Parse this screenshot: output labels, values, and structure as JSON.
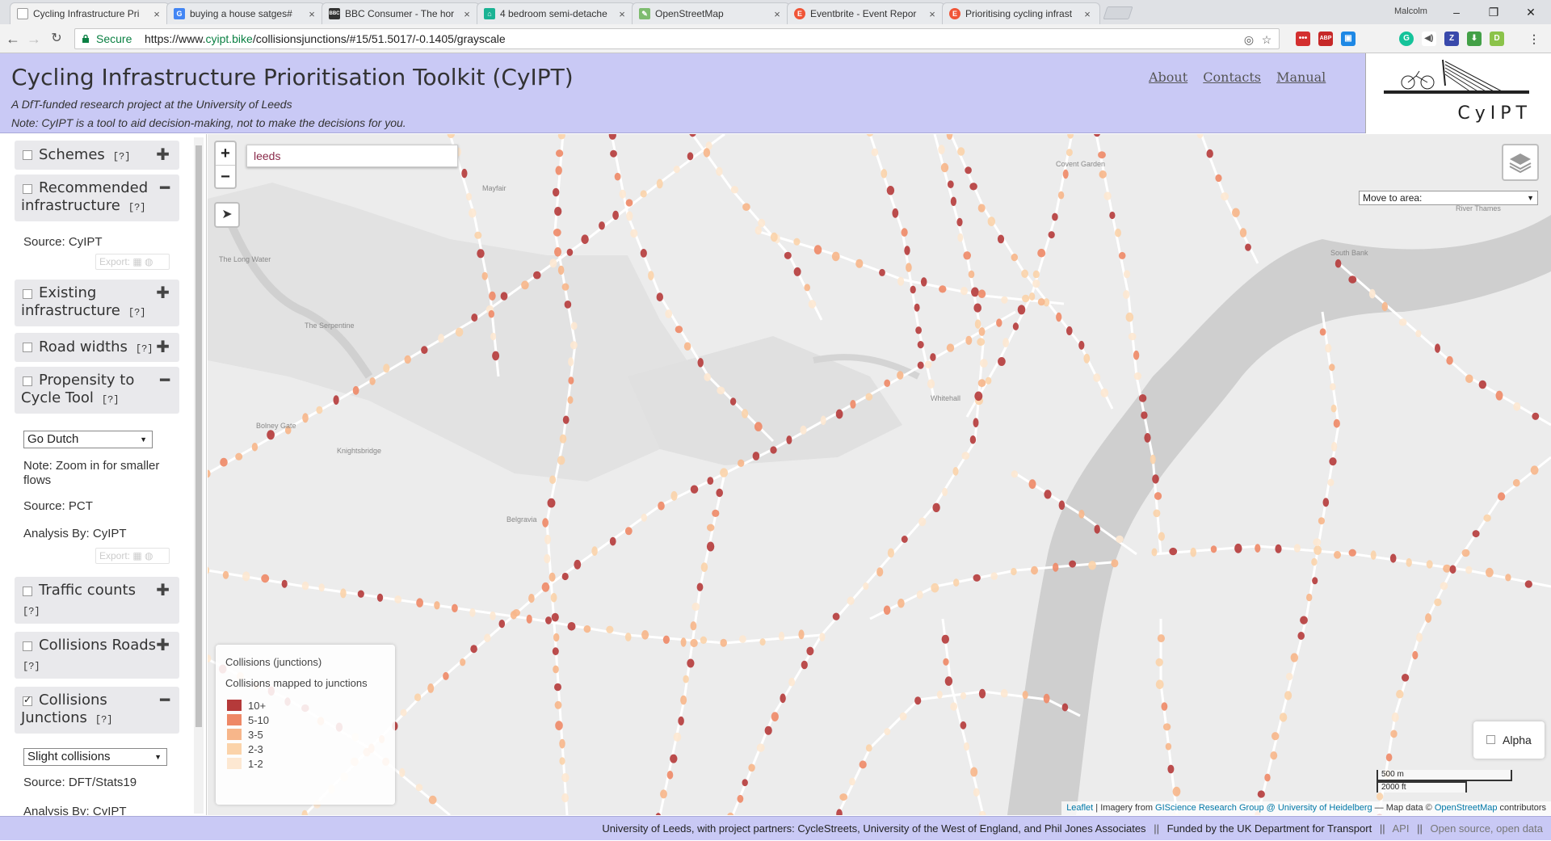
{
  "browser": {
    "tabs": [
      {
        "title": "Cycling Infrastructure Pri",
        "icon": "document-icon",
        "color": "#777777"
      },
      {
        "title": "buying a house satges#",
        "icon": "google-icon",
        "color": "#4285f4"
      },
      {
        "title": "BBC Consumer - The hor",
        "icon": "bbc-icon",
        "color": "#333333"
      },
      {
        "title": "4 bedroom semi-detache",
        "icon": "house-icon",
        "color": "#1ab394"
      },
      {
        "title": "OpenStreetMap",
        "icon": "osm-icon",
        "color": "#7ebc6f"
      },
      {
        "title": "Eventbrite - Event Repor",
        "icon": "eventbrite-icon",
        "color": "#f05537"
      },
      {
        "title": "Prioritising cycling infrast",
        "icon": "eventbrite-icon",
        "color": "#f05537"
      }
    ],
    "user": "Malcolm",
    "secure_label": "Secure",
    "url_scheme": "https://www.",
    "url_host": "cyipt.bike",
    "url_path": "/collisionsjunctions/#15/51.5017/-0.1405/grayscale",
    "extensions": [
      {
        "label": "",
        "color": "#d32f2f",
        "icon": "lastpass-icon"
      },
      {
        "label": "ABP",
        "color": "#c62828",
        "icon": "adblock-icon"
      },
      {
        "label": "",
        "color": "#1e88e5",
        "icon": "extension-icon"
      },
      {
        "label": "G",
        "color": "#15c39a",
        "icon": "grammarly-icon"
      },
      {
        "label": "",
        "color": "#555555",
        "icon": "speaker-icon"
      },
      {
        "label": "Z",
        "color": "#3949ab",
        "icon": "zotero-icon"
      },
      {
        "label": "",
        "color": "#43a047",
        "icon": "download-icon"
      },
      {
        "label": "D",
        "color": "#8bc34a",
        "icon": "d-extension-icon"
      },
      {
        "label": "",
        "color": "#777777",
        "icon": "menu-dots-icon"
      }
    ]
  },
  "site": {
    "title": "Cycling Infrastructure Prioritisation Toolkit (CyIPT)",
    "subtitle1": "A DfT-funded research project at the University of Leeds",
    "subtitle2": "Note: CyIPT is a tool to aid decision-making, not to make the decisions for you.",
    "nav": [
      "About",
      "Contacts",
      "Manual"
    ],
    "logo_text": "CyIPT"
  },
  "sidebar": {
    "help": "[?]",
    "schemes": "Schemes",
    "recommended_1": "Recommended",
    "recommended_2": "infrastructure",
    "recommended_source": "Source: CyIPT",
    "export_label": "Export:",
    "existing_1": "Existing",
    "existing_2": "infrastructure",
    "road_widths": "Road widths",
    "propensity_1": "Propensity to",
    "propensity_2": "Cycle Tool",
    "propensity_select": "Go Dutch",
    "propensity_note_1": "Note: Zoom in for smaller",
    "propensity_note_2": "flows",
    "propensity_source": "Source: PCT",
    "propensity_analysis": "Analysis By: CyIPT",
    "traffic_counts": "Traffic counts",
    "collisions_roads": "Collisions Roads",
    "collisions_junctions_1": "Collisions",
    "collisions_junctions_2": "Junctions",
    "collisions_select": "Slight collisions",
    "collisions_source": "Source: DFT/Stats19",
    "collisions_analysis": "Analysis By: CyIPT"
  },
  "map": {
    "search_value": "leeds",
    "zoom_in": "+",
    "zoom_out": "−",
    "move_to_area": "Move to area:",
    "alpha_label": "Alpha",
    "scale_metric": "500 m",
    "scale_imperial": "2000 ft",
    "attribution": {
      "leaflet": "Leaflet",
      "imagery_prefix": " | Imagery from ",
      "gis_group": "GIScience Research Group @ University of Heidelberg",
      "mapdata_prefix": " — Map data © ",
      "osm": "OpenStreetMap",
      "contributors": " contributors"
    },
    "place_labels": [
      "Mayfair",
      "The Serpentine",
      "Knightsbridge",
      "Belgravia",
      "Bolney Gate",
      "Covent Garden",
      "South Bank",
      "Whitehall",
      "River Thames",
      "The Long Water"
    ]
  },
  "legend": {
    "title": "Collisions (junctions)",
    "description": "Collisions mapped to junctions",
    "items": [
      {
        "label": "10+",
        "color": "#b53a3a"
      },
      {
        "label": "5-10",
        "color": "#ee8866"
      },
      {
        "label": "3-5",
        "color": "#f7b68a"
      },
      {
        "label": "2-3",
        "color": "#fbd3aa"
      },
      {
        "label": "1-2",
        "color": "#fde8d2"
      }
    ]
  },
  "footer": {
    "partners": "University of Leeds, with project partners: CycleStreets, University of the West of England, and Phil Jones Associates",
    "sep": "||",
    "funded": "Funded by the UK Department for Transport",
    "api": "API",
    "open_source": "Open source, open data"
  },
  "colors": {
    "header_bg": "#c9c9f5",
    "map_bg": "#ececec",
    "river": "#cfcfcf",
    "park": "#dedede"
  }
}
